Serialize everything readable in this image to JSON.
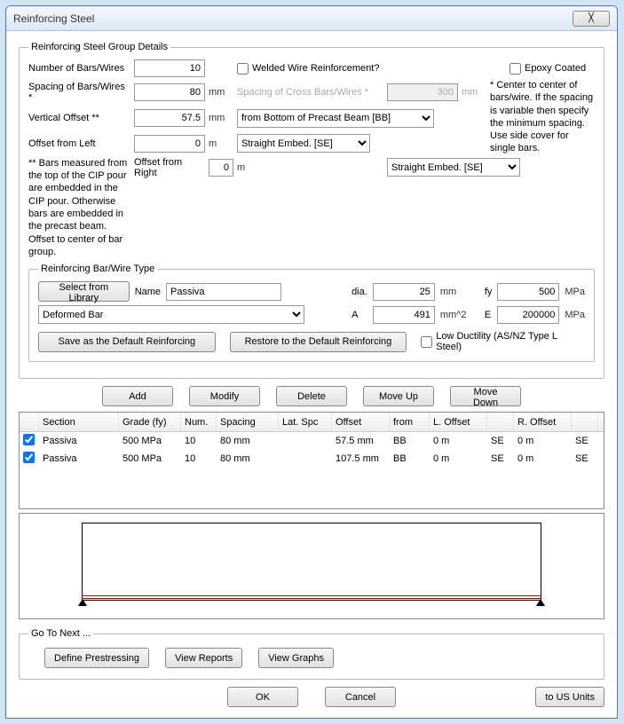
{
  "title": "Reinforcing Steel",
  "group": {
    "legend": "Reinforcing Steel Group Details",
    "num_bars_label": "Number of Bars/Wires",
    "num_bars": "10",
    "welded_label": "Welded Wire Reinforcement?",
    "epoxy_label": "Epoxy Coated",
    "spacing_label": "Spacing of Bars/Wires *",
    "spacing": "80",
    "spacing_unit": "mm",
    "cross_spacing_label": "Spacing of Cross Bars/Wires *",
    "cross_spacing": "300",
    "cross_spacing_unit": "mm",
    "note1": "* Center to center of bars/wire. If the spacing is variable then specify the minimum spacing.  Use side cover for single bars.",
    "voffset_label": "Vertical Offset **",
    "voffset": "57.5",
    "voffset_unit": "mm",
    "voffset_from": "from Bottom of Precast Beam [BB]",
    "loffset_label": "Offset from Left",
    "loffset": "0",
    "loffset_unit": "m",
    "lembed": "Straight Embed. [SE]",
    "roffset_label": "Offset from Right",
    "roffset": "0",
    "roffset_unit": "m",
    "rembed": "Straight Embed. [SE]",
    "note2": "** Bars measured from the top of the CIP pour are embedded in the CIP pour.  Otherwise bars are embedded in the precast beam.  Offset to center of bar group."
  },
  "bartype": {
    "legend": "Reinforcing Bar/Wire Type",
    "select_lib": "Select from Library",
    "name_label": "Name",
    "name": "Passiva",
    "dia_label": "dia.",
    "dia": "25",
    "dia_unit": "mm",
    "fy_label": "fy",
    "fy": "500",
    "fy_unit": "MPa",
    "deform": "Deformed Bar",
    "a_label": "A",
    "a": "491",
    "a_unit": "mm^2",
    "e_label": "E",
    "e": "200000",
    "e_unit": "MPa",
    "save_default": "Save as the Default Reinforcing",
    "restore_default": "Restore to the Default Reinforcing",
    "low_duct": "Low Ductility (AS/NZ Type L Steel)"
  },
  "actions": {
    "add": "Add",
    "modify": "Modify",
    "delete": "Delete",
    "moveup": "Move Up",
    "movedown": "Move Down"
  },
  "table": {
    "headers": {
      "section": "Section",
      "grade": "Grade (fy)",
      "num": "Num.",
      "spacing": "Spacing",
      "latspc": "Lat. Spc",
      "offset": "Offset",
      "from": "from",
      "loffset": "L. Offset",
      "roffset": "R. Offset"
    },
    "rows": [
      {
        "section": "Passiva",
        "grade": "500 MPa",
        "num": "10",
        "spacing": "80 mm",
        "latspc": "",
        "offset": "57.5 mm",
        "from": "BB",
        "loffset": "0 m",
        "lcode": "SE",
        "roffset": "0 m",
        "rcode": "SE"
      },
      {
        "section": "Passiva",
        "grade": "500 MPa",
        "num": "10",
        "spacing": "80 mm",
        "latspc": "",
        "offset": "107.5 mm",
        "from": "BB",
        "loffset": "0 m",
        "lcode": "SE",
        "roffset": "0 m",
        "rcode": "SE"
      }
    ]
  },
  "goto": {
    "legend": "Go To Next ...",
    "prestress": "Define Prestressing",
    "reports": "View Reports",
    "graphs": "View Graphs"
  },
  "footer": {
    "ok": "OK",
    "cancel": "Cancel",
    "units": "to US Units"
  }
}
